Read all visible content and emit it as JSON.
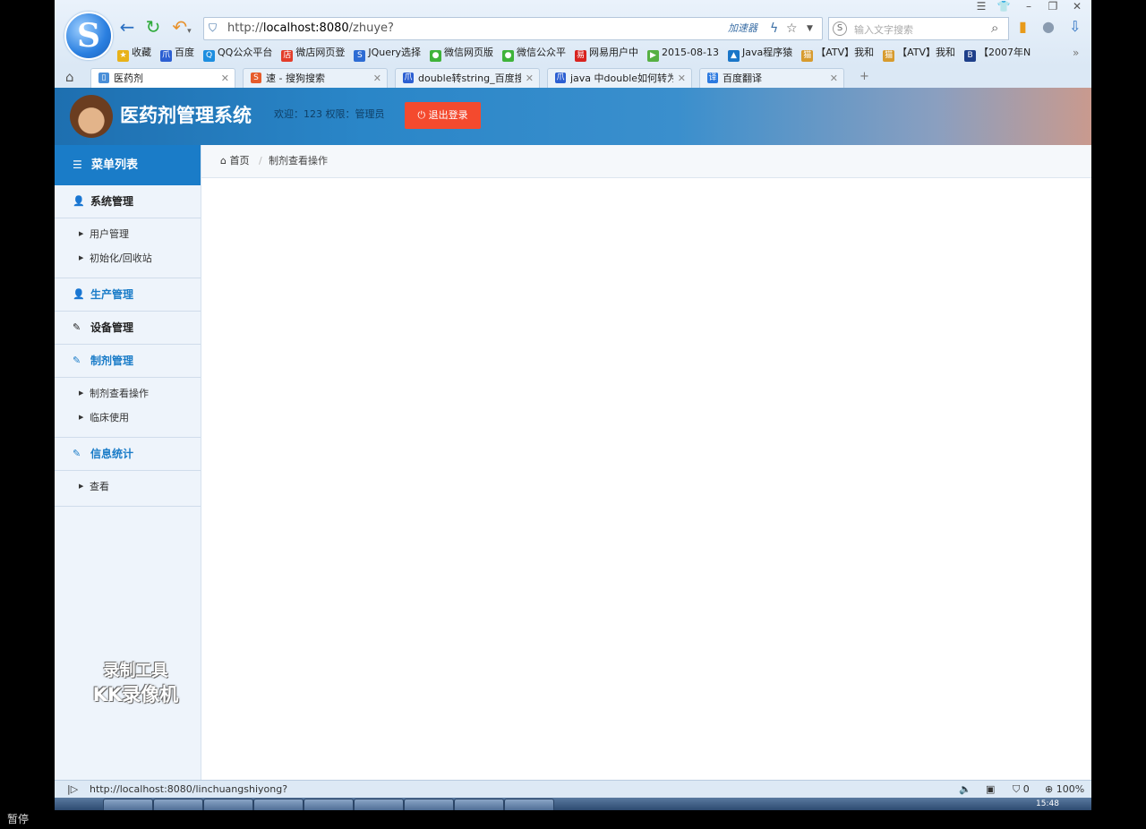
{
  "browser": {
    "window_controls": [
      "☰",
      "👕",
      "–",
      "❐",
      "✕"
    ],
    "address": {
      "url_prefix": "http://",
      "url_host": "localhost:8080",
      "url_path": "/zhuye?",
      "accelerator_label": "加速器"
    },
    "search": {
      "placeholder": "输入文字搜索"
    },
    "bookmarks": [
      {
        "label": "收藏",
        "icon": "star-icon",
        "color": "#e8b21a"
      },
      {
        "label": "百度",
        "icon": "baidu-icon",
        "color": "#2c5fd2"
      },
      {
        "label": "QQ公众平台",
        "icon": "qq-icon",
        "color": "#1d8ee0"
      },
      {
        "label": "微店网页登",
        "icon": "weidian-icon",
        "color": "#e33d2a"
      },
      {
        "label": "JQuery选择",
        "icon": "sogou-icon",
        "color": "#2d6cd4"
      },
      {
        "label": "微信网页版",
        "icon": "wechat-icon",
        "color": "#3fb33a"
      },
      {
        "label": "微信公众平",
        "icon": "wechat-icon",
        "color": "#3fb33a"
      },
      {
        "label": "网易用户中",
        "icon": "netease-icon",
        "color": "#d8231f"
      },
      {
        "label": "2015-08-13",
        "icon": "play-icon",
        "color": "#56b043"
      },
      {
        "label": "Java程序猿",
        "icon": "mountain-icon",
        "color": "#1a76c8"
      },
      {
        "label": "【ATV】我和",
        "icon": "cat-icon",
        "color": "#d79b2e"
      },
      {
        "label": "【ATV】我和",
        "icon": "cat-icon",
        "color": "#d79b2e"
      },
      {
        "label": "【2007年N",
        "icon": "bo-icon",
        "color": "#1e3f8a"
      }
    ],
    "tabs": [
      {
        "label": "医药剂",
        "icon": "page-icon",
        "color": "#4a8fd8",
        "active": true
      },
      {
        "label": "速 - 搜狗搜索",
        "icon": "sogou-icon",
        "color": "#e65c2b",
        "active": false
      },
      {
        "label": "double转string_百度搜",
        "icon": "baidu-icon",
        "color": "#2c5fd2",
        "active": false
      },
      {
        "label": "java 中double如何转为",
        "icon": "baidu-icon",
        "color": "#2c5fd2",
        "active": false
      },
      {
        "label": "百度翻译",
        "icon": "translate-icon",
        "color": "#2c7ae0",
        "active": false
      }
    ],
    "status_url": "http://localhost:8080/linchuangshiyong?",
    "status_right": {
      "shield_count": "0",
      "zoom": "100%"
    }
  },
  "app": {
    "title": "医药剂管理系统",
    "welcome": "欢迎：123 权限：管理员",
    "logout_label": "退出登录",
    "menu_header": "菜单列表",
    "sections": [
      {
        "label": "系统管理",
        "icon": "user-icon",
        "color": "#222",
        "items": [
          "用户管理",
          "初始化/回收站"
        ]
      },
      {
        "label": "生产管理",
        "icon": "user-icon",
        "color": "#1a7cc8",
        "items": []
      },
      {
        "label": "设备管理",
        "icon": "edit-icon",
        "color": "#222",
        "items": []
      },
      {
        "label": "制剂管理",
        "icon": "edit-icon",
        "color": "#1a7cc8",
        "items": [
          "制剂查看操作",
          "临床使用"
        ]
      },
      {
        "label": "信息统计",
        "icon": "edit-icon",
        "color": "#1a7cc8",
        "items": [
          "查看"
        ]
      }
    ],
    "breadcrumb": {
      "home": "首页",
      "current": "制剂查看操作"
    }
  },
  "overlay": {
    "watermark_line1": "录制工具",
    "watermark_line2": "KK录像机",
    "pause_label": "暂停",
    "clock": "15:48"
  }
}
